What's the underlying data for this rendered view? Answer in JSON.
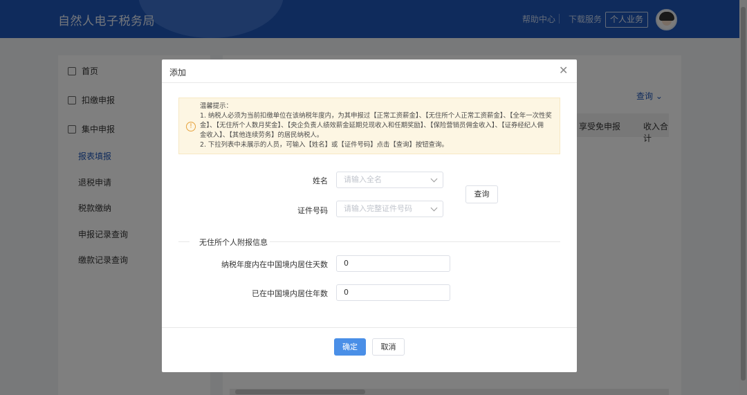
{
  "header": {
    "brand": "自然人电子税务局",
    "help": "帮助中心",
    "download": "下载服务",
    "personal": "个人业务"
  },
  "sidebar": {
    "items": [
      {
        "label": "首页",
        "icon": "home-icon"
      },
      {
        "label": "扣缴申报",
        "icon": "document-icon"
      },
      {
        "label": "集中申报",
        "icon": "form-icon"
      }
    ],
    "subitems": [
      "报表填报",
      "退税申请",
      "税款缴纳",
      "申报记录查询",
      "缴款记录查询"
    ]
  },
  "content": {
    "query": "查询",
    "columns": [
      "享受免申报",
      "收入合计"
    ]
  },
  "modal": {
    "title": "添加",
    "notice": {
      "lines": [
        "温馨提示：",
        "1. 纳税人必须为当前扣缴单位在该纳税年度内，为其申报过【正常工资薪金】、【无住所个人正常工资薪金】、【全年一次性奖",
        "金】、【无住所个人数月奖金】、【央企负责人绩效薪金延期兑现收入和任期奖励】、【保险营销员佣金收入】、【证券经纪人佣",
        "金收入】、【其他连续劳务】的居民纳税人。",
        "2. 下拉列表中未展示的人员，可输入【姓名】或【证件号码】点击【查询】按钮查询。"
      ]
    },
    "name_label": "姓名",
    "name_placeholder": "请输入全名",
    "id_label": "证件号码",
    "id_placeholder": "请输入完整证件号码",
    "query_button": "查询",
    "section_title": "无住所个人附报信息",
    "days_label": "纳税年度内在中国境内居住天数",
    "days_value": "0",
    "years_label": "已在中国境内居住年数",
    "years_value": "0",
    "confirm": "确定",
    "cancel": "取消"
  }
}
